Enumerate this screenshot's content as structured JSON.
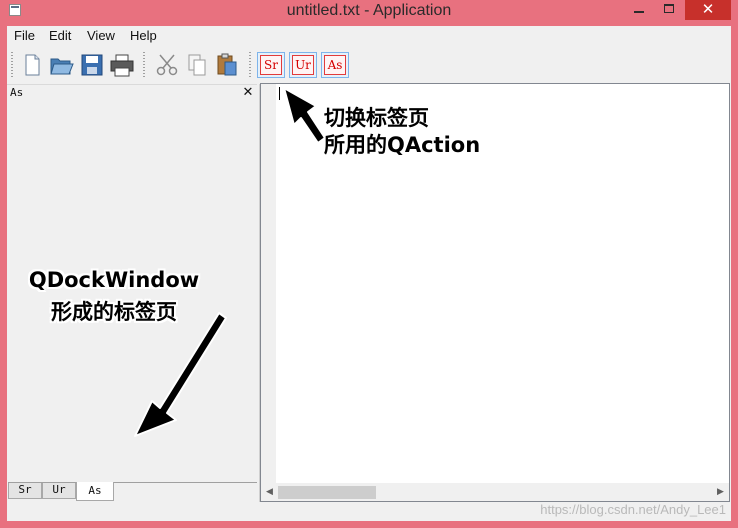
{
  "window": {
    "title": "untitled.txt - Application",
    "close_glyph": "✕"
  },
  "menu": {
    "items": [
      {
        "label": "File"
      },
      {
        "label": "Edit"
      },
      {
        "label": "View"
      },
      {
        "label": "Help"
      }
    ]
  },
  "toolbar": {
    "icons": [
      "new-file-icon",
      "open-folder-icon",
      "save-icon",
      "print-icon",
      "cut-icon",
      "copy-icon",
      "paste-icon"
    ],
    "actions": [
      {
        "label": "Sr"
      },
      {
        "label": "Ur"
      },
      {
        "label": "As"
      }
    ]
  },
  "dock": {
    "title": "As",
    "close_glyph": "✕",
    "tabs": [
      {
        "label": "Sr",
        "selected": false
      },
      {
        "label": "Ur",
        "selected": false
      },
      {
        "label": "As",
        "selected": true
      }
    ]
  },
  "editor": {
    "text": "",
    "scroll_left_glyph": "◀",
    "scroll_right_glyph": "▶"
  },
  "annotations": {
    "action_line1": "切换标签页",
    "action_line2": "所用的QAction",
    "dock_line1": "QDockWindow",
    "dock_line2": "形成的标签页"
  },
  "watermark": "https://blog.csdn.net/Andy_Lee1",
  "colors": {
    "title_bar": "#e8717f",
    "close_button": "#c7302b",
    "action_border": "#e23b3b",
    "action_text": "#d40000"
  }
}
